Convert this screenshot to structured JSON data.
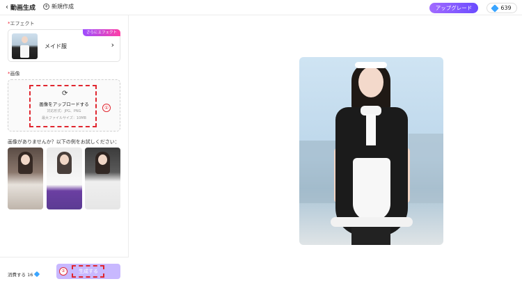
{
  "topbar": {
    "title": "動画生成",
    "new_label": "新規作成",
    "upgrade_label": "アップグレード",
    "credits": "639"
  },
  "left": {
    "effect_section_label": "エフェクト",
    "effect_name": "メイド服",
    "more_effects_badge": "さらにエフェクト",
    "image_section_label": "画像",
    "upload": {
      "title": "画像をアップロードする",
      "formats": "対応形式：JPG、PNG",
      "max_size": "最大ファイルサイズ：10MB",
      "step_marker": "①"
    },
    "samples_title": "画像がありませんか？以下の例をお試しください：",
    "cost_label": "消費する 16",
    "generate_label": "生成する",
    "generate_step_marker": "②"
  },
  "colors": {
    "accent": "#7b5cff",
    "highlight_dashed": "#e0262f",
    "credit_gem": "#3aa5ff"
  }
}
